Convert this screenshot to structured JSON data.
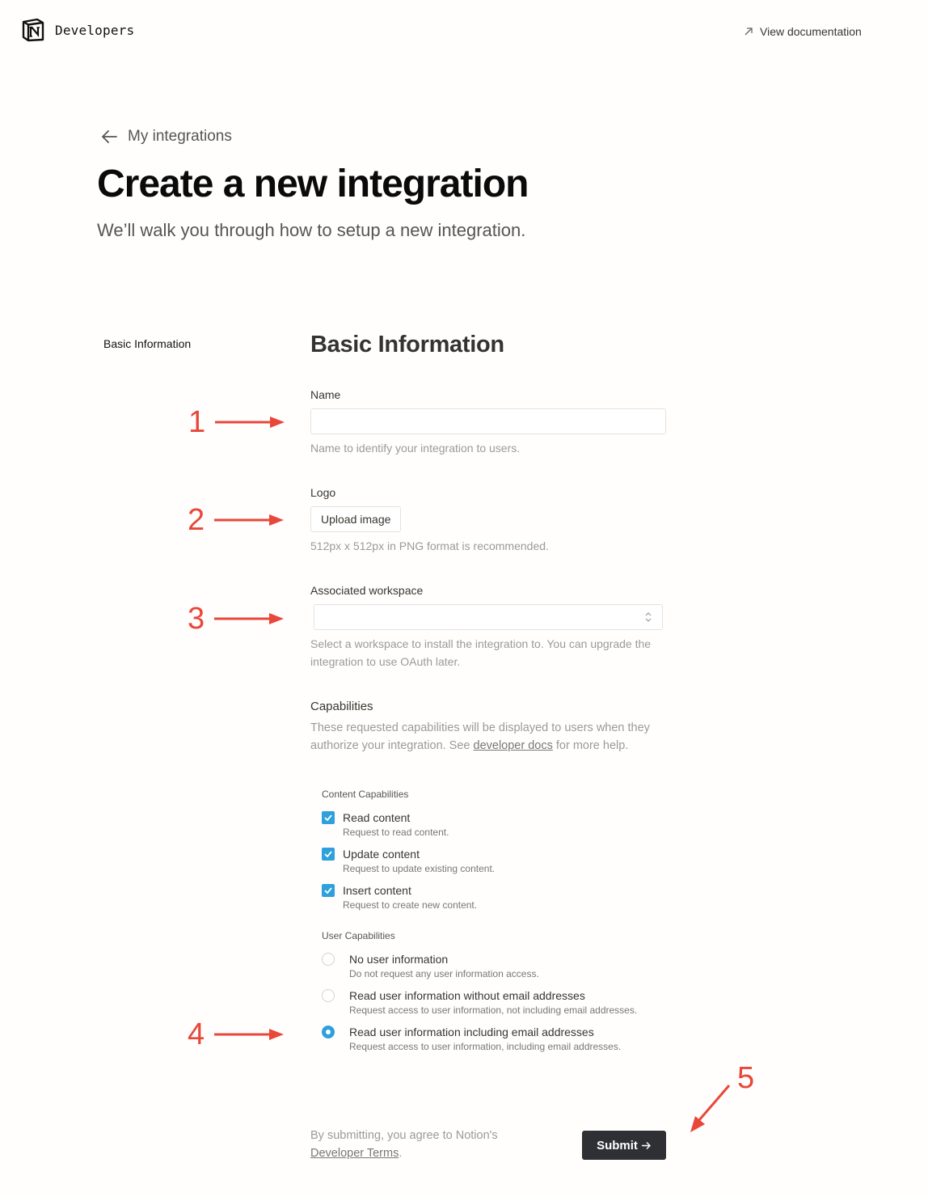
{
  "header": {
    "brand": "Developers",
    "doc_link": "View documentation"
  },
  "page": {
    "back_link": "My integrations",
    "title": "Create a new integration",
    "subtitle": "We’ll walk you through how to setup a new integration."
  },
  "side_nav": {
    "items": [
      {
        "label": "Basic Information"
      }
    ]
  },
  "form": {
    "section_title": "Basic Information",
    "name": {
      "label": "Name",
      "value": "",
      "help": "Name to identify your integration to users."
    },
    "logo": {
      "label": "Logo",
      "button": "Upload image",
      "help": "512px x 512px in PNG format is recommended."
    },
    "workspace": {
      "label": "Associated workspace",
      "value": "",
      "help": "Select a workspace to install the integration to. You can upgrade the integration to use OAuth later."
    },
    "capabilities": {
      "label": "Capabilities",
      "help_prefix": "These requested capabilities will be displayed to users when they authorize your integration. See ",
      "help_link": "developer docs",
      "help_suffix": " for more help.",
      "content_group_label": "Content Capabilities",
      "content": [
        {
          "title": "Read content",
          "desc": "Request to read content.",
          "checked": true
        },
        {
          "title": "Update content",
          "desc": "Request to update existing content.",
          "checked": true
        },
        {
          "title": "Insert content",
          "desc": "Request to create new content.",
          "checked": true
        }
      ],
      "user_group_label": "User Capabilities",
      "user": [
        {
          "title": "No user information",
          "desc": "Do not request any user information access.",
          "selected": false
        },
        {
          "title": "Read user information without email addresses",
          "desc": "Request access to user information, not including email addresses.",
          "selected": false
        },
        {
          "title": "Read user information including email addresses",
          "desc": "Request access to user information, including email addresses.",
          "selected": true
        }
      ]
    },
    "terms_prefix": "By submitting, you agree to Notion's ",
    "terms_link": "Developer Terms",
    "terms_suffix": ".",
    "submit": "Submit"
  },
  "annotations": [
    "1",
    "2",
    "3",
    "4",
    "5"
  ],
  "colors": {
    "accent": "#2ea0dc",
    "submit_bg": "#2f3033",
    "annotation": "#e8473a"
  }
}
